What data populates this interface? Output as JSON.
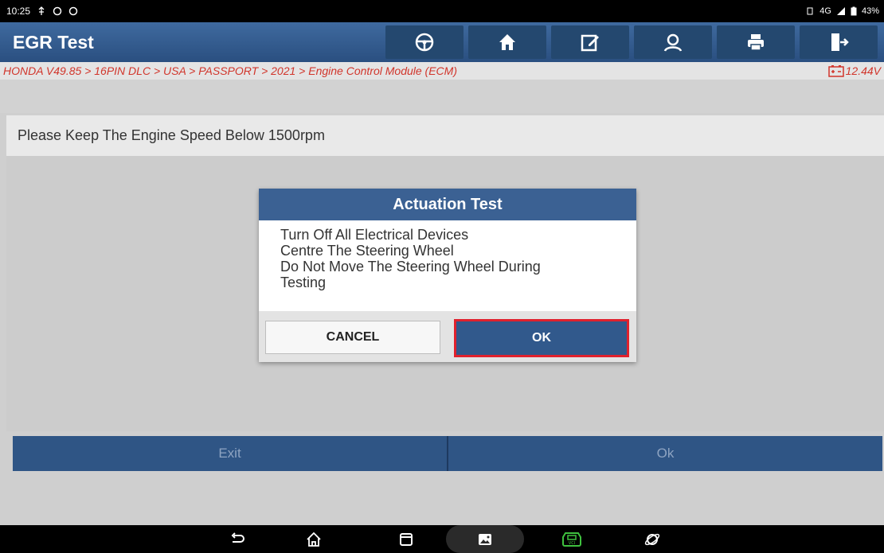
{
  "status_bar": {
    "time": "10:25",
    "network": "4G",
    "battery": "43%"
  },
  "header": {
    "title": "EGR Test",
    "buttons": [
      "wheel-icon",
      "home-icon",
      "edit-icon",
      "user-icon",
      "print-icon",
      "exit-icon"
    ]
  },
  "breadcrumb": {
    "path": "HONDA V49.85 > 16PIN DLC > USA > PASSPORT > 2021 > Engine Control Module (ECM)",
    "voltage": "12.44V"
  },
  "message": "Please Keep The Engine Speed Below 1500rpm",
  "dialog": {
    "title": "Actuation Test",
    "lines": [
      "Turn Off All Electrical Devices",
      "Centre The Steering Wheel",
      "Do Not Move The Steering Wheel During",
      "Testing"
    ],
    "cancel_label": "CANCEL",
    "ok_label": "OK"
  },
  "footer": {
    "exit_label": "Exit",
    "ok_label": "Ok"
  },
  "colors": {
    "header_blue": "#2f5585",
    "breadcrumb_red": "#d1352b",
    "ok_highlight_border": "#e0212d"
  }
}
